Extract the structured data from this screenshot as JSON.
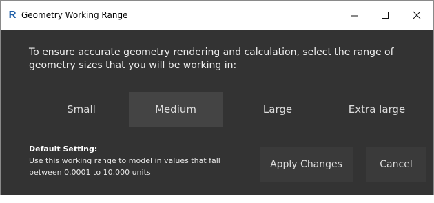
{
  "window": {
    "app_icon_letter": "R",
    "title": "Geometry Working Range",
    "controls": {
      "minimize_icon": "minimize-icon",
      "maximize_icon": "maximize-icon",
      "close_icon": "close-icon"
    }
  },
  "instruction": "To ensure accurate geometry rendering and calculation, select the range of geometry sizes that you will be working in:",
  "ranges": [
    {
      "label": "Small",
      "selected": false
    },
    {
      "label": "Medium",
      "selected": true
    },
    {
      "label": "Large",
      "selected": false
    },
    {
      "label": "Extra large",
      "selected": false
    }
  ],
  "default_setting": {
    "title": "Default Setting:",
    "description": "Use this working range to model in values that fall between 0.0001 to 10,000 units"
  },
  "buttons": {
    "apply": "Apply Changes",
    "cancel": "Cancel"
  },
  "colors": {
    "titlebar": "#ffffff",
    "background": "#333333",
    "selected_option": "#444444",
    "button_background": "#3a3a3a",
    "app_icon": "#1f5fa8"
  }
}
